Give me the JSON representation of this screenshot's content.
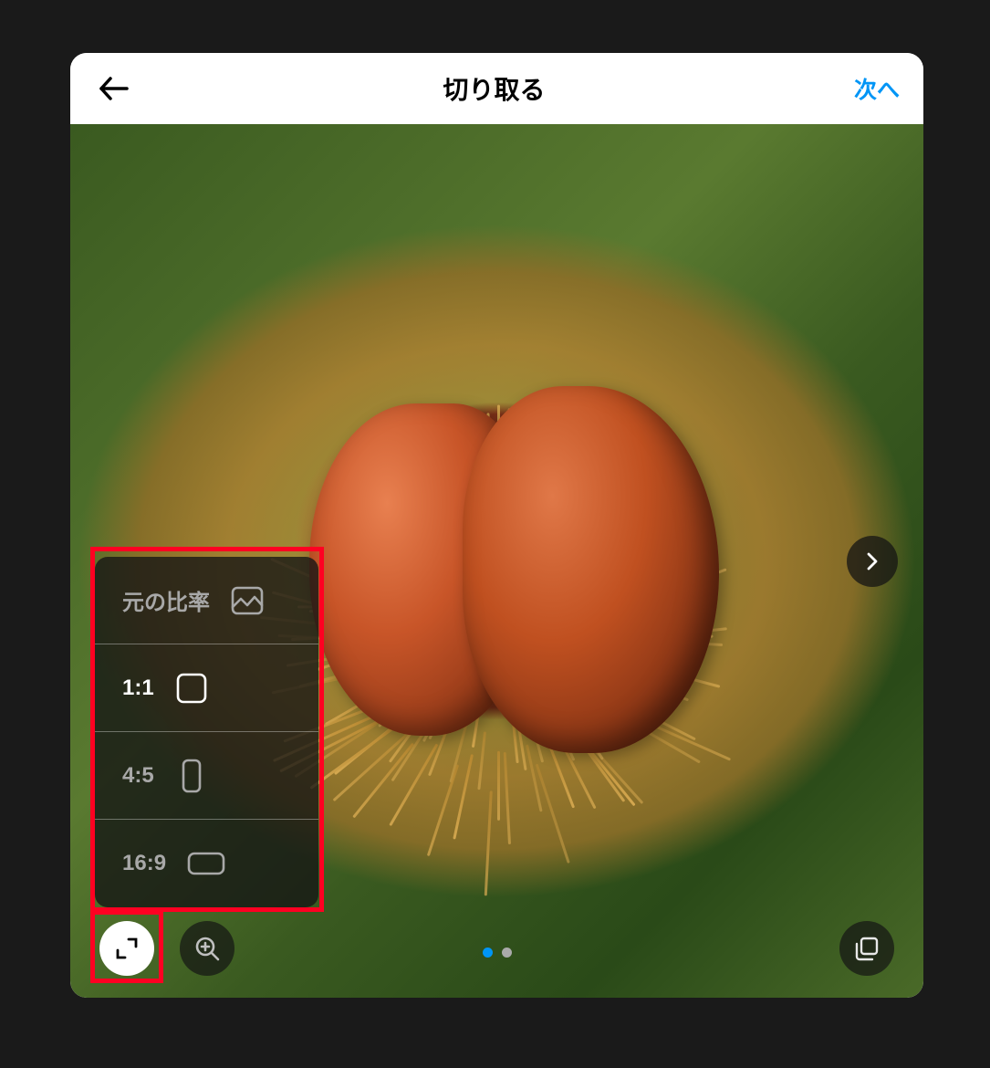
{
  "header": {
    "title": "切り取る",
    "next_label": "次へ"
  },
  "aspect_ratio_menu": {
    "options": [
      {
        "label": "元の比率",
        "icon": "image-icon",
        "selected": false
      },
      {
        "label": "1:1",
        "icon": "square-icon",
        "selected": true
      },
      {
        "label": "4:5",
        "icon": "portrait-rect-icon",
        "selected": false
      },
      {
        "label": "16:9",
        "icon": "landscape-rect-icon",
        "selected": false
      }
    ]
  },
  "pager": {
    "current": 1,
    "total": 2
  },
  "colors": {
    "accent": "#0095f6",
    "highlight": "#ff0022"
  }
}
